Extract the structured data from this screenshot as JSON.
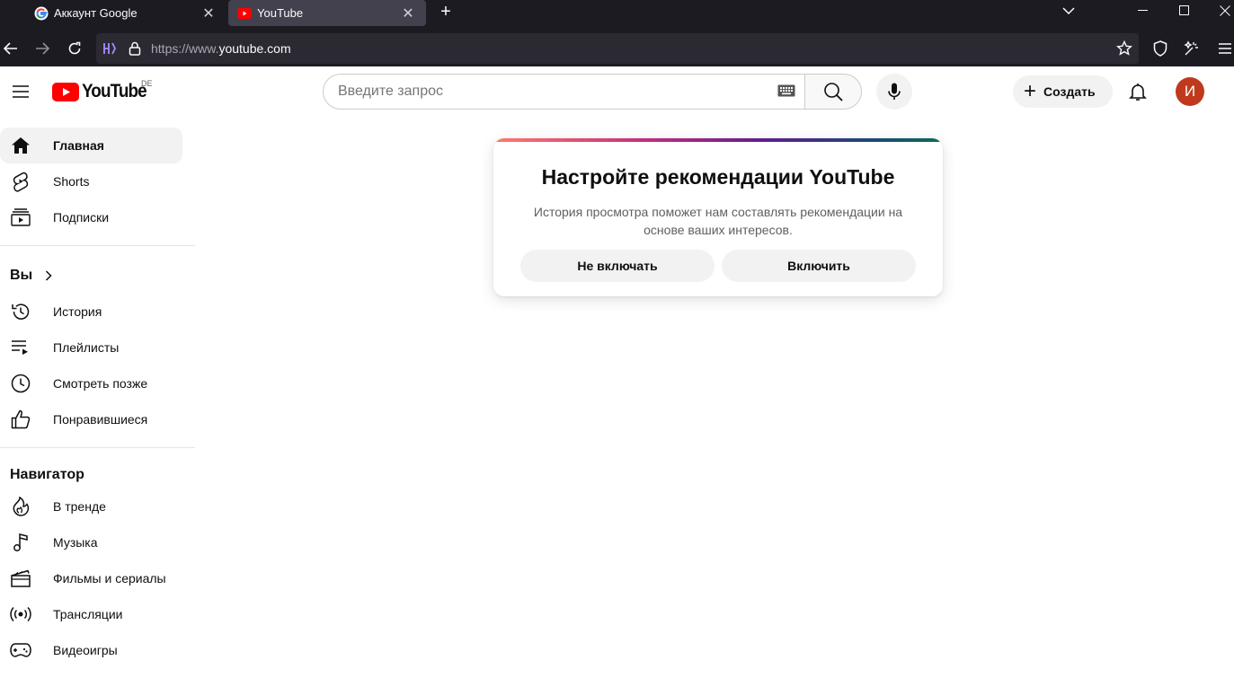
{
  "browser": {
    "tabs": [
      {
        "title": "Аккаунт Google",
        "active": false
      },
      {
        "title": "YouTube",
        "active": true
      }
    ],
    "url_prefix": "https://www.",
    "url_domain": "youtube.com"
  },
  "masthead": {
    "logo_text": "YouTube",
    "region": "DE",
    "search_placeholder": "Введите запрос",
    "create_label": "Создать",
    "avatar_letter": "И"
  },
  "sidebar": {
    "main": [
      {
        "label": "Главная",
        "icon": "home-icon"
      },
      {
        "label": "Shorts",
        "icon": "shorts-icon"
      },
      {
        "label": "Подписки",
        "icon": "subscriptions-icon"
      }
    ],
    "you_heading": "Вы",
    "you": [
      {
        "label": "История",
        "icon": "history-icon"
      },
      {
        "label": "Плейлисты",
        "icon": "playlists-icon"
      },
      {
        "label": "Смотреть позже",
        "icon": "watch-later-icon"
      },
      {
        "label": "Понравившиеся",
        "icon": "like-icon"
      }
    ],
    "explore_heading": "Навигатор",
    "explore": [
      {
        "label": "В тренде",
        "icon": "trending-icon"
      },
      {
        "label": "Музыка",
        "icon": "music-icon"
      },
      {
        "label": "Фильмы и сериалы",
        "icon": "movies-icon"
      },
      {
        "label": "Трансляции",
        "icon": "live-icon"
      },
      {
        "label": "Видеоигры",
        "icon": "gaming-icon"
      }
    ]
  },
  "prompt_card": {
    "title": "Настройте рекомендации YouTube",
    "text": "История просмотра поможет нам составлять рекомендации на основе ваших интересов.",
    "decline_label": "Не включать",
    "accept_label": "Включить"
  },
  "colors": {
    "brand_red": "#ff0000",
    "avatar_bg": "#c0391d"
  }
}
